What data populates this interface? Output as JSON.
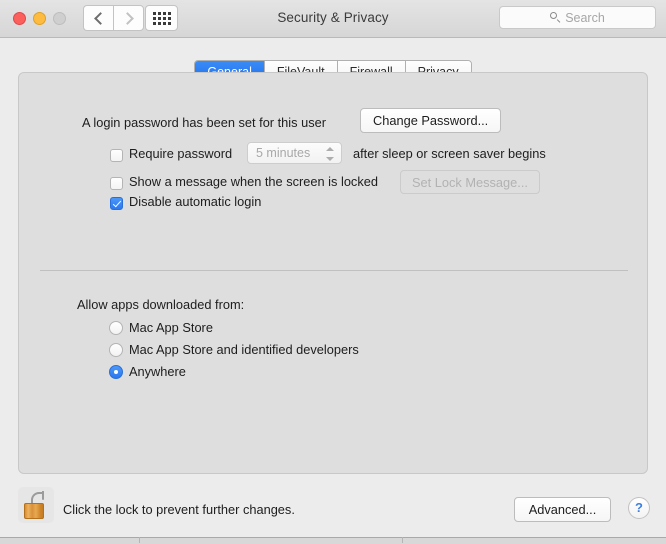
{
  "window": {
    "title": "Security & Privacy"
  },
  "titlebar": {
    "traffic_lights": {
      "close": "close-button",
      "minimize": "minimize-button",
      "zoom": "zoom-button-disabled"
    },
    "back_label": "Back",
    "forward_label": "Forward",
    "show_all_label": "Show All"
  },
  "search": {
    "placeholder": "Search",
    "value": ""
  },
  "tabs": [
    {
      "label": "General",
      "active": true
    },
    {
      "label": "FileVault",
      "active": false
    },
    {
      "label": "Firewall",
      "active": false
    },
    {
      "label": "Privacy",
      "active": false
    }
  ],
  "general": {
    "password_status": "A login password has been set for this user",
    "change_password_label": "Change Password...",
    "require_password": {
      "label": "Require password",
      "checked": false,
      "select_value": "5 minutes",
      "suffix": "after sleep or screen saver begins",
      "enabled": false
    },
    "show_lock_message": {
      "label": "Show a message when the screen is locked",
      "checked": false,
      "button_label": "Set Lock Message...",
      "button_enabled": false
    },
    "disable_automatic_login": {
      "label": "Disable automatic login",
      "checked": true
    },
    "allow_apps_label": "Allow apps downloaded from:",
    "allow_apps_options": [
      {
        "label": "Mac App Store",
        "selected": false
      },
      {
        "label": "Mac App Store and identified developers",
        "selected": false
      },
      {
        "label": "Anywhere",
        "selected": true
      }
    ]
  },
  "footer": {
    "lock_icon": "unlocked-padlock-icon",
    "lock_message": "Click the lock to prevent further changes.",
    "advanced_label": "Advanced...",
    "help_label": "?"
  },
  "colors": {
    "accent_blue": "#2a78ef",
    "tab_active_blue": "#2f7df6",
    "window_background": "#ececec",
    "panel_background": "#dedede",
    "lock_gold": "#d9913a",
    "disabled_text": "#a8a8a8"
  }
}
